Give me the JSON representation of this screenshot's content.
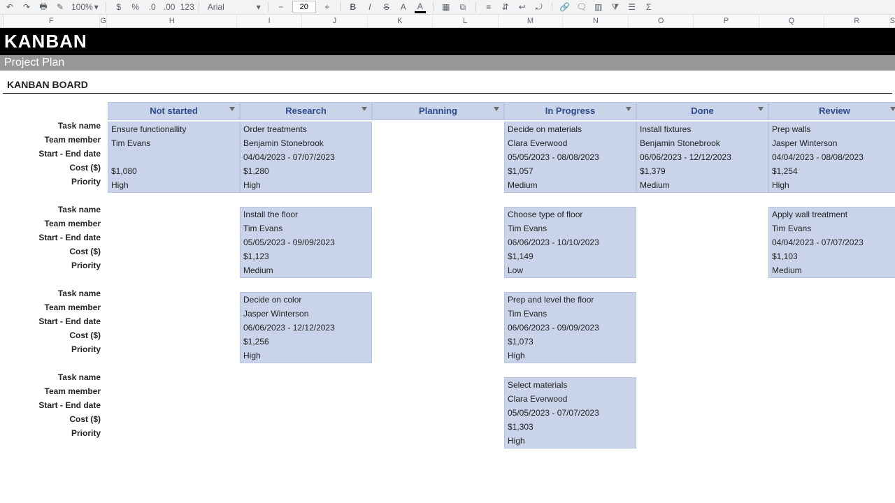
{
  "toolbar": {
    "zoom": "100%",
    "font_name": "Arial",
    "font_size": "20",
    "number_label": "123"
  },
  "colheaders": [
    "F",
    "G",
    "H",
    "I",
    "J",
    "K",
    "L",
    "M",
    "N",
    "O",
    "P",
    "Q",
    "R",
    "S"
  ],
  "title": "KANBAN",
  "subtitle": "Project Plan",
  "section": "KANBAN BOARD",
  "row_labels": [
    "Task name",
    "Team member",
    "Start - End date",
    "Cost ($)",
    "Priority"
  ],
  "status": [
    "Not started",
    "Research",
    "Planning",
    "In Progress",
    "Done",
    "Review"
  ],
  "columns": [
    [
      {
        "task": "Ensure functionallity",
        "member": "Tim Evans",
        "dates": "",
        "cost": "$1,080",
        "priority": "High"
      }
    ],
    [
      {
        "task": "Order treatments",
        "member": "Benjamin Stonebrook",
        "dates": "04/04/2023 - 07/07/2023",
        "cost": "$1,280",
        "priority": "High"
      },
      {
        "task": "Install the floor",
        "member": "Tim Evans",
        "dates": "05/05/2023 - 09/09/2023",
        "cost": "$1,123",
        "priority": "Medium"
      },
      {
        "task": "Decide on color",
        "member": "Jasper Winterson",
        "dates": "06/06/2023 - 12/12/2023",
        "cost": "$1,256",
        "priority": "High"
      }
    ],
    [],
    [
      {
        "task": "Decide on materials",
        "member": "Clara Everwood",
        "dates": "05/05/2023 - 08/08/2023",
        "cost": "$1,057",
        "priority": "Medium"
      },
      {
        "task": "Choose type of floor",
        "member": "Tim Evans",
        "dates": "06/06/2023 - 10/10/2023",
        "cost": "$1,149",
        "priority": "Low"
      },
      {
        "task": "Prep and level the floor",
        "member": "Tim Evans",
        "dates": "06/06/2023 - 09/09/2023",
        "cost": "$1,073",
        "priority": "High"
      },
      {
        "task": "Select materials",
        "member": "Clara Everwood",
        "dates": "05/05/2023 - 07/07/2023",
        "cost": "$1,303",
        "priority": "High"
      }
    ],
    [
      {
        "task": "Install fixtures",
        "member": "Benjamin Stonebrook",
        "dates": "06/06/2023 - 12/12/2023",
        "cost": "$1,379",
        "priority": "Medium"
      }
    ],
    [
      {
        "task": "Prep walls",
        "member": "Jasper Winterson",
        "dates": "04/04/2023 - 08/08/2023",
        "cost": "$1,254",
        "priority": "High"
      },
      {
        "task": "Apply wall treatment",
        "member": "Tim Evans",
        "dates": "04/04/2023 - 07/07/2023",
        "cost": "$1,103",
        "priority": "Medium"
      }
    ]
  ],
  "max_rows": 4
}
